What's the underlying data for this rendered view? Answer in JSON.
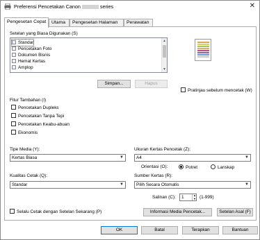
{
  "window": {
    "title_prefix": "Preferensi Pencetakan Canon",
    "title_suffix": "series",
    "close_symbol": "✕"
  },
  "tabs": [
    {
      "label": "Pengesetan Cepat",
      "active": true
    },
    {
      "label": "Utama",
      "active": false
    },
    {
      "label": "Pengesetan Halaman",
      "active": false
    },
    {
      "label": "Perawatan",
      "active": false
    }
  ],
  "common_settings": {
    "label": "Setelan yang Biasa Digunakan (S)",
    "items": [
      {
        "label": "Standar",
        "icon": "printer-icon",
        "selected": true
      },
      {
        "label": "Pencetakan Foto",
        "icon": "photo-icon",
        "selected": false
      },
      {
        "label": "Dokumen Bisnis",
        "icon": "document-icon",
        "selected": false
      },
      {
        "label": "Hemat Kertas",
        "icon": "paper-save-icon",
        "selected": false
      },
      {
        "label": "Amplop",
        "icon": "envelope-icon",
        "selected": false
      }
    ],
    "save_button": "Simpan...",
    "delete_button": "Hapus"
  },
  "preview": {
    "checkbox_label": "Pratinjau sebelum mencetak (W)",
    "checked": false
  },
  "additional_features": {
    "label": "Fitur Tambahan (I)",
    "items": [
      {
        "label": "Pencetakan Dupleks",
        "checked": false
      },
      {
        "label": "Pencetakan Tanpa Tepi",
        "checked": false
      },
      {
        "label": "Pencetakan Keabu-abuan",
        "checked": false
      },
      {
        "label": "Ekonomis",
        "checked": false
      }
    ]
  },
  "media_type": {
    "label": "Tipe Media (Y):",
    "value": "Kertas Biasa"
  },
  "paper_size": {
    "label": "Ukuran Kertas Pencetak (Z):",
    "value": "A4"
  },
  "orientation": {
    "label": "Orientasi (O):",
    "options": [
      {
        "label": "Potret",
        "selected": true
      },
      {
        "label": "Lanskap",
        "selected": false
      }
    ]
  },
  "print_quality": {
    "label": "Kualitas Cetak (Q):",
    "value": "Standar"
  },
  "paper_source": {
    "label": "Sumber Kertas (R):",
    "value": "Pilih Secara Otomatis"
  },
  "copies": {
    "label": "Salinan (C):",
    "value": "1",
    "range": "(1-999)"
  },
  "always_print": {
    "label": "Selalu Cetak dengan Setelan Sekarang (P)",
    "checked": false
  },
  "media_info_button": "Informasi Media Pencetak...",
  "defaults_button": "Setelan Asal (F)",
  "footer": {
    "ok": "OK",
    "cancel": "Batal",
    "apply": "Terapkan",
    "help": "Bantuan"
  },
  "colors": {
    "accent": "#0078d7",
    "button_bg": "#e1e1e1",
    "border": "#adadad"
  }
}
